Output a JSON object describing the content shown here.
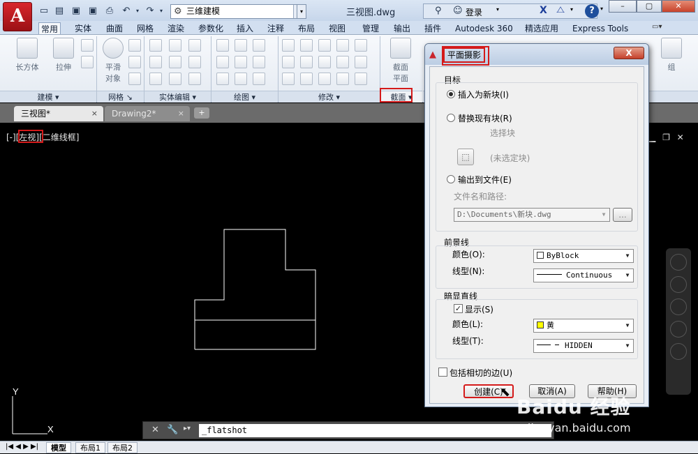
{
  "titlebar": {
    "logo": "A",
    "workspace": "三维建模",
    "doc_title": "三视图.dwg",
    "login": "登录",
    "help": "?"
  },
  "ribbon_tabs": [
    "常用",
    "实体",
    "曲面",
    "网格",
    "渲染",
    "参数化",
    "插入",
    "注释",
    "布局",
    "视图",
    "管理",
    "输出",
    "插件",
    "Autodesk 360",
    "精选应用",
    "Express Tools"
  ],
  "active_tab": "常用",
  "ribbon": {
    "box_label": "长方体",
    "extrude_label": "拉伸",
    "smooth_label_1": "平滑",
    "smooth_label_2": "对象",
    "section_label_1": "截面",
    "section_label_2": "平面",
    "group_label": "组",
    "panels": {
      "modeling": "建模",
      "mesh": "网格",
      "solid_edit": "实体编辑",
      "draw": "绘图",
      "modify": "修改",
      "section": "截面"
    }
  },
  "file_tabs": [
    {
      "label": "三视图*",
      "close": "×"
    },
    {
      "label": "Drawing2*",
      "close": "×"
    }
  ],
  "viewport": {
    "label_prefix": "[-][",
    "view_name": "左视",
    "label_suffix": "][二维线框]",
    "ucs_y": "Y",
    "ucs_x": "X"
  },
  "command_line": {
    "text": "_flatshot"
  },
  "status_tabs": [
    "模型",
    "布局1",
    "布局2"
  ],
  "dialog": {
    "title": "平面摄影",
    "close": "X",
    "target_group": "目标",
    "opt_insert": "插入为新块(I)",
    "opt_replace": "替换现有块(R)",
    "select_block": "选择块",
    "no_block": "(未选定块)",
    "opt_export": "输出到文件(E)",
    "filename_label": "文件名和路径:",
    "filename_value": "D:\\Documents\\新块.dwg",
    "browse": "...",
    "fg_group": "前景线",
    "fg_color_label": "颜色(O):",
    "fg_color_value": "ByBlock",
    "fg_linetype_label": "线型(N):",
    "fg_linetype_value": "Continuous",
    "hidden_group": "暗显直线",
    "show_label": "显示(S)",
    "hid_color_label": "颜色(L):",
    "hid_color_value": "黄",
    "hid_color_hex": "#ffff00",
    "hid_linetype_label": "线型(T):",
    "hid_linetype_value": "HIDDEN",
    "tangent_label": "包括相切的边(U)",
    "create": "创建(C)",
    "cancel": "取消(A)",
    "help": "帮助(H)"
  },
  "watermark": {
    "logo": "Baidu 经验",
    "url": "jingyan.baidu.com"
  },
  "colors": {
    "annotation_red": "#d41a1a",
    "viewport_bg": "#000000",
    "drawing_line": "#ffffff"
  }
}
